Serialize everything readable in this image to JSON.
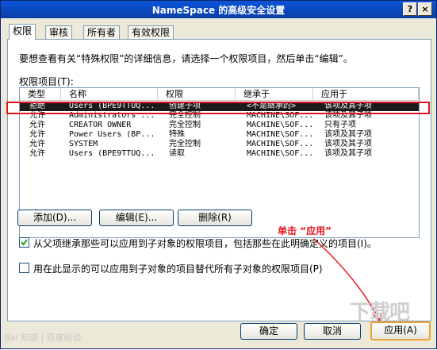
{
  "window": {
    "title": "NameSpace 的高级安全设置",
    "help_glyph": "?",
    "close_glyph": "×"
  },
  "tabs": [
    {
      "label": "权限",
      "active": true
    },
    {
      "label": "审核",
      "active": false
    },
    {
      "label": "所有者",
      "active": false
    },
    {
      "label": "有效权限",
      "active": false
    }
  ],
  "panel": {
    "description": "要想查看有关“特殊权限”的详细信息，请选择一个权限项目，然后单击“编辑”。",
    "list_label": "权限项目(T):"
  },
  "table": {
    "columns": [
      "类型",
      "名称",
      "权限",
      "继承于",
      "应用于"
    ],
    "rows": [
      [
        "拒绝",
        "Users (BPE9TTUQ...",
        "创建子项",
        "<不是继承的>",
        "该项及其子项"
      ],
      [
        "允许",
        "Administrators ...",
        "完全控制",
        "MACHINE\\SOF...",
        "该项及其子项"
      ],
      [
        "允许",
        "CREATOR OWNER",
        "完全控制",
        "MACHINE\\SOF...",
        "只有子项"
      ],
      [
        "允许",
        "Power Users (BP...",
        "特殊",
        "MACHINE\\SOF...",
        "该项及其子项"
      ],
      [
        "允许",
        "SYSTEM",
        "完全控制",
        "MACHINE\\SOF...",
        "该项及其子项"
      ],
      [
        "允许",
        "Users (BPE9TTUQ...",
        "读取",
        "MACHINE\\SOF...",
        "该项及其子项"
      ]
    ]
  },
  "buttons": {
    "add": "添加(D)...",
    "edit": "编辑(E)...",
    "remove": "删除(R)",
    "ok": "确定",
    "cancel": "取消",
    "apply": "应用(A)"
  },
  "checkboxes": [
    {
      "label": "从父项继承那些可以应用到子对象的权限项目，包括那些在此明确定义的项目(I)。",
      "checked": true
    },
    {
      "label": "用在此显示的可以应用到子对象的项目替代所有子对象的权限项目(P)",
      "checked": false
    }
  ],
  "annotation": {
    "text": "单击 “应用”",
    "color": "#e8141e"
  },
  "watermarks": {
    "left": "Bai 知道 | 百度经验",
    "right": "下载吧"
  },
  "colors": {
    "titlebar": "#0a55d8",
    "dialog_bg": "#ece9d8",
    "selection_bg": "#1b1b1b",
    "highlight_red": "#e0141e",
    "apply_highlight": "#f0a030"
  }
}
